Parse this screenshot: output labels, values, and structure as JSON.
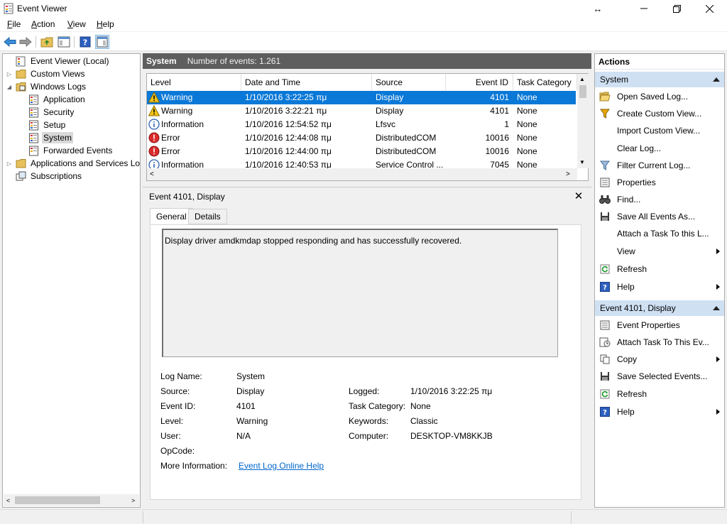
{
  "window": {
    "title": "Event Viewer"
  },
  "menu": [
    {
      "pre": "",
      "u": "F",
      "post": "ile"
    },
    {
      "pre": "",
      "u": "A",
      "post": "ction"
    },
    {
      "pre": "",
      "u": "V",
      "post": "iew"
    },
    {
      "pre": "",
      "u": "H",
      "post": "elp"
    }
  ],
  "tree": {
    "root": "Event Viewer (Local)",
    "custom_views": "Custom Views",
    "windows_logs": "Windows Logs",
    "application": "Application",
    "security": "Security",
    "setup": "Setup",
    "system": "System",
    "forwarded": "Forwarded Events",
    "apps_services": "Applications and Services Lo",
    "subscriptions": "Subscriptions"
  },
  "log_header": {
    "name": "System",
    "count_text": "Number of events: 1.261"
  },
  "columns": {
    "level": "Level",
    "date": "Date and Time",
    "source": "Source",
    "event_id": "Event ID",
    "task": "Task Category"
  },
  "events": [
    {
      "level": "Warning",
      "icon": "warning-icon",
      "date": "1/10/2016 3:22:25 πμ",
      "source": "Display",
      "id": "4101",
      "task": "None"
    },
    {
      "level": "Warning",
      "icon": "warning-icon",
      "date": "1/10/2016 3:22:21 πμ",
      "source": "Display",
      "id": "4101",
      "task": "None"
    },
    {
      "level": "Information",
      "icon": "info-icon",
      "date": "1/10/2016 12:54:52 πμ",
      "source": "Lfsvc",
      "id": "1",
      "task": "None"
    },
    {
      "level": "Error",
      "icon": "error-icon",
      "date": "1/10/2016 12:44:08 πμ",
      "source": "DistributedCOM",
      "id": "10016",
      "task": "None"
    },
    {
      "level": "Error",
      "icon": "error-icon",
      "date": "1/10/2016 12:44:00 πμ",
      "source": "DistributedCOM",
      "id": "10016",
      "task": "None"
    },
    {
      "level": "Information",
      "icon": "info-icon",
      "date": "1/10/2016 12:40:53 πμ",
      "source": "Service Control ...",
      "id": "7045",
      "task": "None"
    }
  ],
  "detail": {
    "title": "Event 4101, Display",
    "tab_general": "General",
    "tab_details": "Details",
    "message": "Display driver amdkmdap stopped responding and has successfully recovered.",
    "log_name_label": "Log Name:",
    "log_name": "System",
    "source_label": "Source:",
    "source": "Display",
    "logged_label": "Logged:",
    "logged": "1/10/2016 3:22:25 πμ",
    "event_id_label": "Event ID:",
    "event_id": "4101",
    "task_label": "Task Category:",
    "task": "None",
    "level_label": "Level:",
    "level": "Warning",
    "keywords_label": "Keywords:",
    "keywords": "Classic",
    "user_label": "User:",
    "user": "N/A",
    "computer_label": "Computer:",
    "computer": "DESKTOP-VM8KKJB",
    "opcode_label": "OpCode:",
    "opcode": "",
    "more_label": "More Information:",
    "more_link": "Event Log Online Help"
  },
  "actions": {
    "title": "Actions",
    "section1": "System",
    "s1_items": [
      "Open Saved Log...",
      "Create Custom View...",
      "Import Custom View...",
      "Clear Log...",
      "Filter Current Log...",
      "Properties",
      "Find...",
      "Save All Events As...",
      "Attach a Task To this L...",
      "View",
      "Refresh",
      "Help"
    ],
    "section2": "Event 4101, Display",
    "s2_items": [
      "Event Properties",
      "Attach Task To This Ev...",
      "Copy",
      "Save Selected Events...",
      "Refresh",
      "Help"
    ]
  }
}
